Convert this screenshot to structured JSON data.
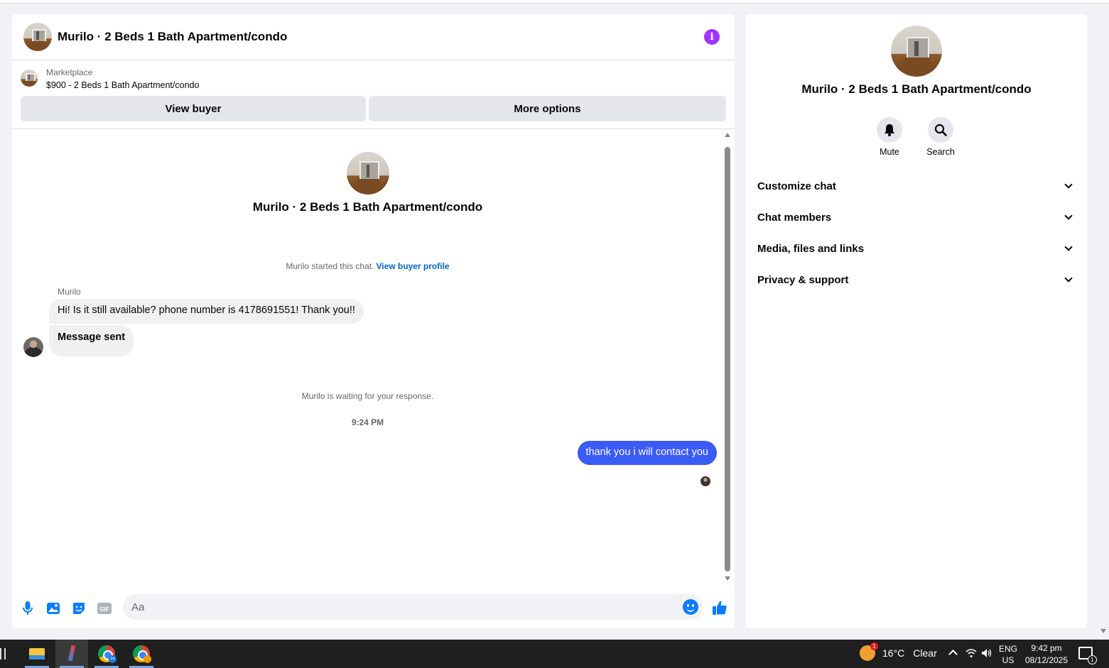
{
  "header": {
    "title": "Murilo · 2 Beds 1 Bath Apartment/condo"
  },
  "listing": {
    "label": "Marketplace",
    "price_title": "$900 - 2 Beds 1 Bath Apartment/condo"
  },
  "buttons": {
    "view_buyer": "View buyer",
    "more_options": "More options"
  },
  "conversation": {
    "intro_title": "Murilo · 2 Beds 1 Bath Apartment/condo",
    "started_text": "Murilo started this chat.",
    "view_profile_link": "View buyer profile",
    "sender_name": "Murilo",
    "incoming": [
      "Hi! Is it still available? phone number is 4178691551! Thank you!!",
      "Message sent"
    ],
    "waiting_text": "Murilo is waiting for your response.",
    "timestamp": "9:24 PM",
    "outgoing": "thank you i will contact you"
  },
  "composer": {
    "placeholder": "Aa",
    "icons": [
      "microphone-icon",
      "photo-icon",
      "sticker-icon",
      "gif-icon",
      "emoji-icon",
      "thumbs-up-icon"
    ],
    "gif_label": "GIF"
  },
  "side_panel": {
    "title": "Murilo · 2 Beds 1 Bath Apartment/condo",
    "actions": [
      {
        "label": "Mute",
        "icon": "bell-icon"
      },
      {
        "label": "Search",
        "icon": "search-icon"
      }
    ],
    "menu": [
      "Customize chat",
      "Chat members",
      "Media, files and links",
      "Privacy & support"
    ]
  },
  "taskbar": {
    "weather_temp": "16°C",
    "weather_desc": "Clear",
    "weather_badge": "1",
    "lang_top": "ENG",
    "lang_bottom": "US",
    "time": "9:42 pm",
    "date": "08/12/2025",
    "notification_count": "1"
  },
  "colors": {
    "accent": "#0a7cff",
    "outgoing_bubble": "#3b5bf5",
    "info_icon": "#a033ff",
    "link": "#0064d1"
  }
}
